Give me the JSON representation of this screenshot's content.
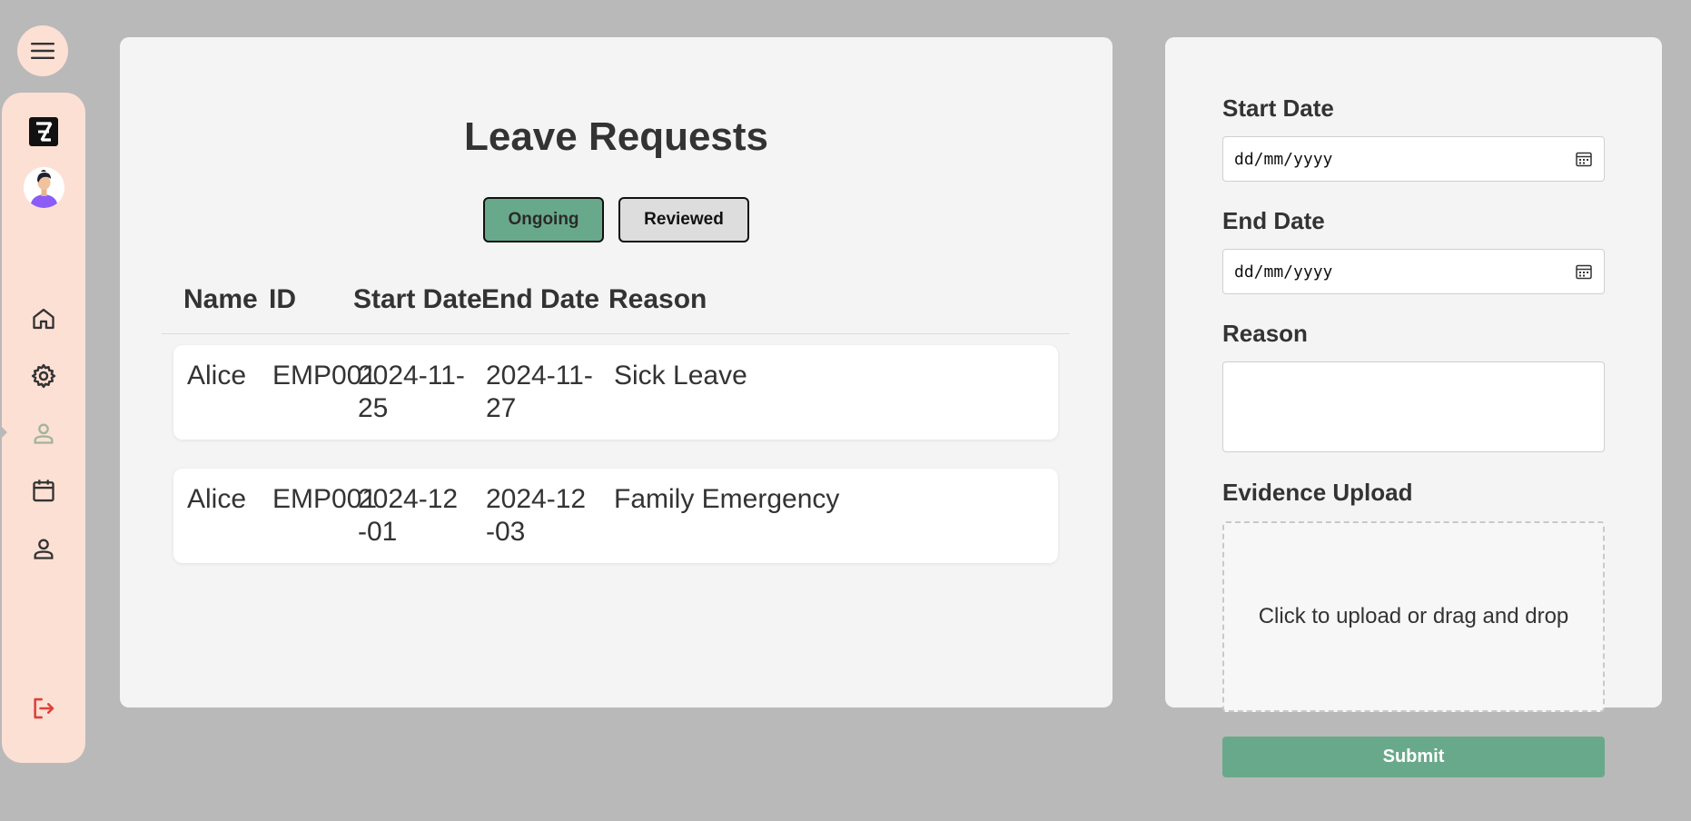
{
  "app": {
    "icons": {
      "menu": "hamburger-menu-icon",
      "logo": "brand-logo-icon",
      "home": "home-icon",
      "settings": "gear-icon",
      "person": "person-icon",
      "calendar": "calendar-icon",
      "account": "account-icon",
      "logout": "logout-icon"
    },
    "colors": {
      "sidebar_bg": "#fde0d4",
      "accent_green": "#69a98b",
      "logout_red": "#e0403a",
      "page_bg": "#b9b9b9"
    }
  },
  "requests": {
    "title": "Leave Requests",
    "tabs": [
      {
        "label": "Ongoing",
        "active": true
      },
      {
        "label": "Reviewed",
        "active": false
      }
    ],
    "columns": [
      "Name",
      "ID",
      "Start Date",
      "End Date",
      "Reason"
    ],
    "rows": [
      {
        "name": "Alice",
        "id": "EMP001",
        "start_date": "2024-11-25",
        "end_date": "2024-11-27",
        "reason": "Sick Leave"
      },
      {
        "name": "Alice",
        "id": "EMP001",
        "start_date": "2024-12-01",
        "end_date": "2024-12-03",
        "reason": "Family Emergency"
      }
    ]
  },
  "form": {
    "start_date_label": "Start Date",
    "start_date_placeholder": "dd/mm/yyyy",
    "end_date_label": "End Date",
    "end_date_placeholder": "dd/mm/yyyy",
    "reason_label": "Reason",
    "reason_value": "",
    "evidence_label": "Evidence Upload",
    "upload_text": "Click to upload or drag and drop",
    "submit_label": "Submit"
  }
}
